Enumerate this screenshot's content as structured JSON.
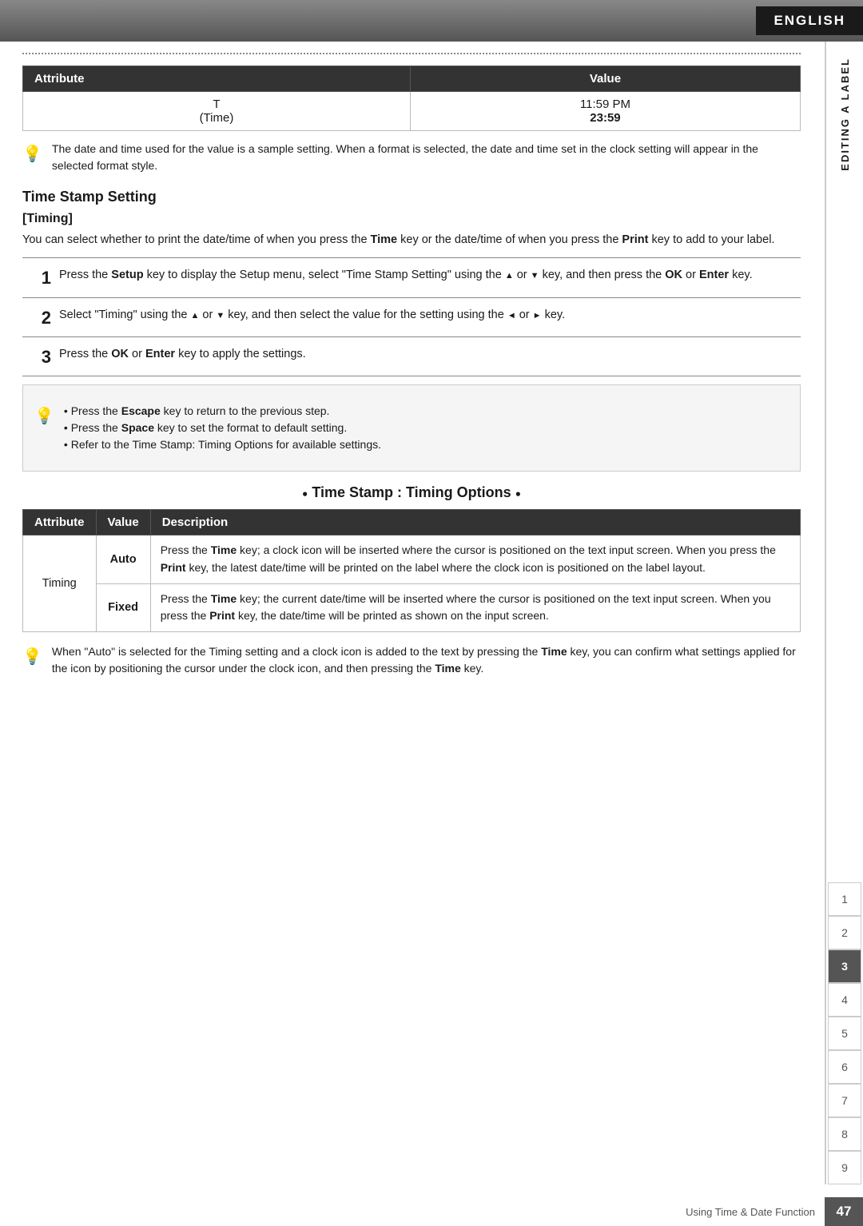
{
  "header": {
    "language": "ENGLISH"
  },
  "sidebar": {
    "editing_label": "EDITING A LABEL",
    "chapters": [
      "1",
      "2",
      "3",
      "4",
      "5",
      "6",
      "7",
      "8",
      "9"
    ],
    "active_chapter": "3"
  },
  "attr_table_1": {
    "col1": "Attribute",
    "col2": "Value",
    "row1_attr": "T",
    "row1_sub": "(Time)",
    "row1_val1": "11:59 PM",
    "row1_val2": "23:59"
  },
  "note1": {
    "text": "The date and time used for the value is a sample setting. When a format is selected, the date and time set in the clock setting will appear in the selected format style."
  },
  "time_stamp_setting": {
    "heading": "Time Stamp Setting",
    "sub_heading": "[Timing]",
    "body": "You can select whether to print the date/time of when you press the Time key or the date/time of when you press the Print key to add to your label."
  },
  "steps": [
    {
      "num": "1",
      "text_before": "Press the ",
      "bold1": "Setup",
      "text_mid1": " key to display the Setup menu, select \"Time Stamp Setting\" using the ",
      "text_mid2": " or ",
      "text_mid3": " key, and then press the ",
      "bold2": "OK",
      "text_mid4": " or ",
      "bold3": "Enter",
      "text_end": " key."
    },
    {
      "num": "2",
      "text_before": "Select \"Timing\" using the ",
      "text_mid1": " or ",
      "text_mid2": " key, and then select the value for the setting using the ",
      "text_mid3": " or ",
      "text_end": " key."
    },
    {
      "num": "3",
      "text_before": "Press the ",
      "bold1": "OK",
      "text_mid": " or ",
      "bold2": "Enter",
      "text_end": " key to apply the settings."
    }
  ],
  "tips": {
    "items": [
      {
        "bold": "Escape",
        "text": " key to return to the previous step."
      },
      {
        "bold": "Space",
        "text": " key to set the format to default setting."
      },
      {
        "text": " Refer to the Time Stamp: Timing Options for available settings."
      }
    ]
  },
  "timing_options_heading": "Time Stamp : Timing Options",
  "timing_table": {
    "col1": "Attribute",
    "col2": "Value",
    "col3": "Description",
    "attr": "Timing",
    "row1_val": "Auto",
    "row1_desc": "Press the Time key; a clock icon will be inserted where the cursor is positioned on the text input screen. When you press the Print key, the latest date/time will be printed on the label where the clock icon is positioned on the label layout.",
    "row2_val": "Fixed",
    "row2_desc": "Press the Time key; the current date/time will be inserted where the cursor is positioned on the text input screen. When you press the Print key, the date/time will be printed as shown on the input screen."
  },
  "note2": {
    "text_before": "When \"Auto\" is selected for the Timing setting and a clock icon is added to the text by pressing the ",
    "bold1": "Time",
    "text_mid1": " key, you can confirm what settings applied for the icon by positioning the cursor under the clock icon, and then pressing the ",
    "bold2": "Time",
    "text_end": " key."
  },
  "footer": {
    "text": "Using Time & Date Function",
    "page": "47"
  }
}
